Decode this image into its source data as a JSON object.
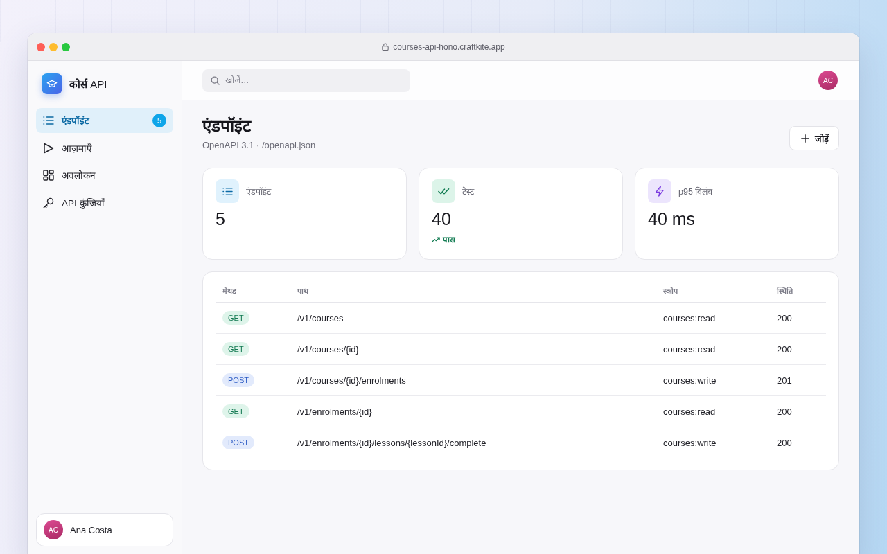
{
  "window": {
    "url": "courses-api-hono.craftkite.app"
  },
  "sidebar": {
    "brand": "**कोर्स** API",
    "items": [
      {
        "label": "एंडपॉइंट",
        "kind": "list",
        "selected": true,
        "badge": "5"
      },
      {
        "label": "आज़माएँ",
        "kind": "play",
        "selected": false
      },
      {
        "label": "अवलोकन",
        "kind": "grid",
        "selected": false
      },
      {
        "label": "API कुंजियाँ",
        "kind": "key",
        "selected": false
      }
    ],
    "user": {
      "initials": "AC",
      "name": "Ana Costa"
    }
  },
  "topbar": {
    "search": {
      "placeholder": "खोजें…"
    },
    "avatar": "AC"
  },
  "page": {
    "title": "एंडपॉइंट",
    "subtitle": "OpenAPI 3.1 · /openapi.json",
    "add_button": "जोड़ें"
  },
  "stats": [
    {
      "kind": "list",
      "label": "एंडपॉइंट",
      "value": "5"
    },
    {
      "kind": "check",
      "label": "टेस्ट",
      "value": "40",
      "trend": "पास"
    },
    {
      "kind": "bolt",
      "label": "p95 विलंब",
      "value": "40 ms"
    }
  ],
  "table": {
    "columns": [
      "मेथड",
      "पाथ",
      "स्कोप",
      "स्थिति"
    ],
    "rows": [
      {
        "method": {
          "label": "GET",
          "kind": "get"
        },
        "path": "/v1/courses",
        "scope": "courses:read",
        "status": "200"
      },
      {
        "method": {
          "label": "GET",
          "kind": "get"
        },
        "path": "/v1/courses/{id}",
        "scope": "courses:read",
        "status": "200"
      },
      {
        "method": {
          "label": "POST",
          "kind": "post"
        },
        "path": "/v1/courses/{id}/enrolments",
        "scope": "courses:write",
        "status": "201"
      },
      {
        "method": {
          "label": "GET",
          "kind": "get"
        },
        "path": "/v1/enrolments/{id}",
        "scope": "courses:read",
        "status": "200"
      },
      {
        "method": {
          "label": "POST",
          "kind": "post"
        },
        "path": "/v1/enrolments/{id}/lessons/{lessonId}/complete",
        "scope": "courses:write",
        "status": "200"
      }
    ]
  }
}
